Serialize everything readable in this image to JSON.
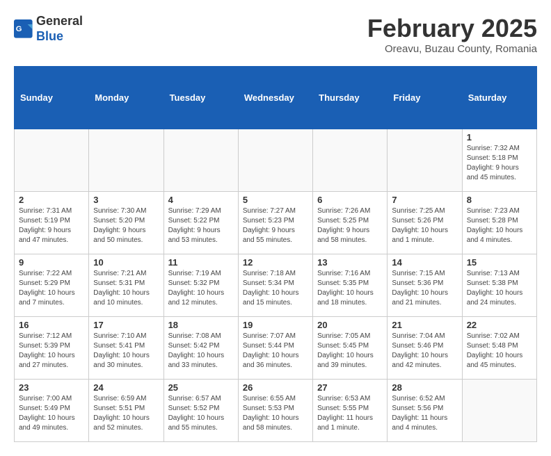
{
  "header": {
    "logo_general": "General",
    "logo_blue": "Blue",
    "month_title": "February 2025",
    "subtitle": "Oreavu, Buzau County, Romania"
  },
  "calendar": {
    "days_of_week": [
      "Sunday",
      "Monday",
      "Tuesday",
      "Wednesday",
      "Thursday",
      "Friday",
      "Saturday"
    ],
    "weeks": [
      [
        {
          "day": "",
          "info": ""
        },
        {
          "day": "",
          "info": ""
        },
        {
          "day": "",
          "info": ""
        },
        {
          "day": "",
          "info": ""
        },
        {
          "day": "",
          "info": ""
        },
        {
          "day": "",
          "info": ""
        },
        {
          "day": "1",
          "info": "Sunrise: 7:32 AM\nSunset: 5:18 PM\nDaylight: 9 hours and 45 minutes."
        }
      ],
      [
        {
          "day": "2",
          "info": "Sunrise: 7:31 AM\nSunset: 5:19 PM\nDaylight: 9 hours and 47 minutes."
        },
        {
          "day": "3",
          "info": "Sunrise: 7:30 AM\nSunset: 5:20 PM\nDaylight: 9 hours and 50 minutes."
        },
        {
          "day": "4",
          "info": "Sunrise: 7:29 AM\nSunset: 5:22 PM\nDaylight: 9 hours and 53 minutes."
        },
        {
          "day": "5",
          "info": "Sunrise: 7:27 AM\nSunset: 5:23 PM\nDaylight: 9 hours and 55 minutes."
        },
        {
          "day": "6",
          "info": "Sunrise: 7:26 AM\nSunset: 5:25 PM\nDaylight: 9 hours and 58 minutes."
        },
        {
          "day": "7",
          "info": "Sunrise: 7:25 AM\nSunset: 5:26 PM\nDaylight: 10 hours and 1 minute."
        },
        {
          "day": "8",
          "info": "Sunrise: 7:23 AM\nSunset: 5:28 PM\nDaylight: 10 hours and 4 minutes."
        }
      ],
      [
        {
          "day": "9",
          "info": "Sunrise: 7:22 AM\nSunset: 5:29 PM\nDaylight: 10 hours and 7 minutes."
        },
        {
          "day": "10",
          "info": "Sunrise: 7:21 AM\nSunset: 5:31 PM\nDaylight: 10 hours and 10 minutes."
        },
        {
          "day": "11",
          "info": "Sunrise: 7:19 AM\nSunset: 5:32 PM\nDaylight: 10 hours and 12 minutes."
        },
        {
          "day": "12",
          "info": "Sunrise: 7:18 AM\nSunset: 5:34 PM\nDaylight: 10 hours and 15 minutes."
        },
        {
          "day": "13",
          "info": "Sunrise: 7:16 AM\nSunset: 5:35 PM\nDaylight: 10 hours and 18 minutes."
        },
        {
          "day": "14",
          "info": "Sunrise: 7:15 AM\nSunset: 5:36 PM\nDaylight: 10 hours and 21 minutes."
        },
        {
          "day": "15",
          "info": "Sunrise: 7:13 AM\nSunset: 5:38 PM\nDaylight: 10 hours and 24 minutes."
        }
      ],
      [
        {
          "day": "16",
          "info": "Sunrise: 7:12 AM\nSunset: 5:39 PM\nDaylight: 10 hours and 27 minutes."
        },
        {
          "day": "17",
          "info": "Sunrise: 7:10 AM\nSunset: 5:41 PM\nDaylight: 10 hours and 30 minutes."
        },
        {
          "day": "18",
          "info": "Sunrise: 7:08 AM\nSunset: 5:42 PM\nDaylight: 10 hours and 33 minutes."
        },
        {
          "day": "19",
          "info": "Sunrise: 7:07 AM\nSunset: 5:44 PM\nDaylight: 10 hours and 36 minutes."
        },
        {
          "day": "20",
          "info": "Sunrise: 7:05 AM\nSunset: 5:45 PM\nDaylight: 10 hours and 39 minutes."
        },
        {
          "day": "21",
          "info": "Sunrise: 7:04 AM\nSunset: 5:46 PM\nDaylight: 10 hours and 42 minutes."
        },
        {
          "day": "22",
          "info": "Sunrise: 7:02 AM\nSunset: 5:48 PM\nDaylight: 10 hours and 45 minutes."
        }
      ],
      [
        {
          "day": "23",
          "info": "Sunrise: 7:00 AM\nSunset: 5:49 PM\nDaylight: 10 hours and 49 minutes."
        },
        {
          "day": "24",
          "info": "Sunrise: 6:59 AM\nSunset: 5:51 PM\nDaylight: 10 hours and 52 minutes."
        },
        {
          "day": "25",
          "info": "Sunrise: 6:57 AM\nSunset: 5:52 PM\nDaylight: 10 hours and 55 minutes."
        },
        {
          "day": "26",
          "info": "Sunrise: 6:55 AM\nSunset: 5:53 PM\nDaylight: 10 hours and 58 minutes."
        },
        {
          "day": "27",
          "info": "Sunrise: 6:53 AM\nSunset: 5:55 PM\nDaylight: 11 hours and 1 minute."
        },
        {
          "day": "28",
          "info": "Sunrise: 6:52 AM\nSunset: 5:56 PM\nDaylight: 11 hours and 4 minutes."
        },
        {
          "day": "",
          "info": ""
        }
      ]
    ]
  }
}
